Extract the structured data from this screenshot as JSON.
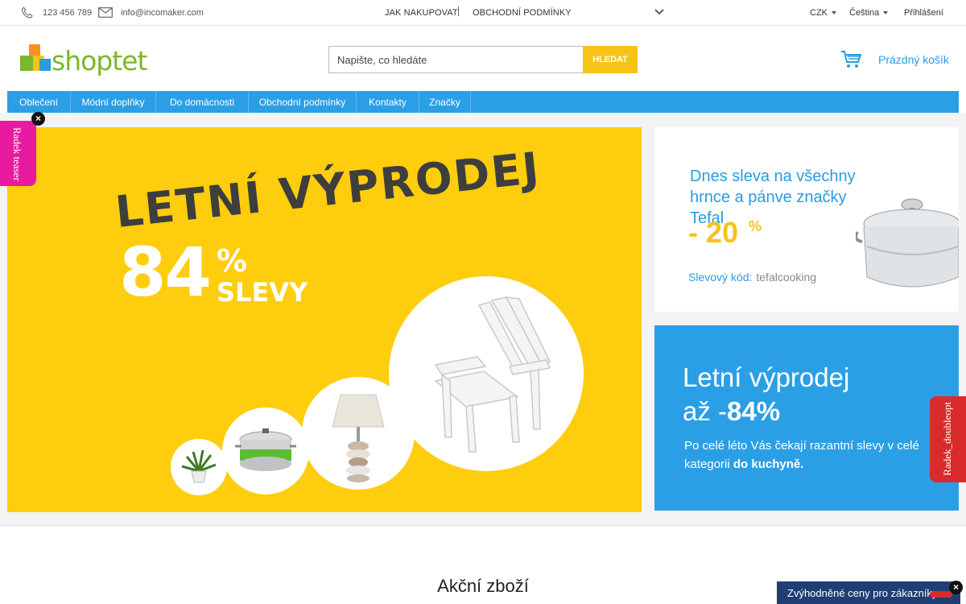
{
  "topbar": {
    "phone": "123 456 789",
    "email": "info@incomaker.com",
    "links": [
      "JAK NAKUPOVAT",
      "OBCHODNÍ PODMÍNKY"
    ],
    "currency": "CZK",
    "language": "Čeština",
    "login": "Přihlášení"
  },
  "header": {
    "logo_text": "shoptet",
    "search_placeholder": "Napište, co hledáte",
    "search_button": "HLEDAT",
    "cart_label": "Prázdný košík"
  },
  "nav": {
    "items": [
      "Oblečení",
      "Módní doplňky",
      "Do domácnosti",
      "Obchodní podmínky",
      "Kontakty",
      "Značky"
    ]
  },
  "banner": {
    "title": "LETNÍ VÝPRODEJ",
    "number": "84",
    "percent": "%",
    "slevy": "SLEVY"
  },
  "promo1": {
    "title": "Dnes sleva na všechny hrnce a pánve značky Tefal",
    "discount": "- 20",
    "percent": "%",
    "code_label": "Slevový kód:",
    "code_value": "tefalcooking"
  },
  "promo2": {
    "title_line1": "Letní výprodej",
    "title_line2_prefix": "až -",
    "title_line2_bold": "84%",
    "text_prefix": "Po celé léto Vás čekají razantní slevy v celé kategorii ",
    "text_bold": "do kuchyně."
  },
  "teasers": {
    "left": "Radek teaser",
    "right": "Radek_doubleopt"
  },
  "section_title": "Akční zboží",
  "bottom_bar": "Zvýhodněné ceny pro zákazníky",
  "colors": {
    "brand_blue": "#2b9fe6",
    "brand_yellow": "#fecd0e",
    "teaser_pink": "#e81ba0",
    "teaser_red": "#d92b2b"
  }
}
